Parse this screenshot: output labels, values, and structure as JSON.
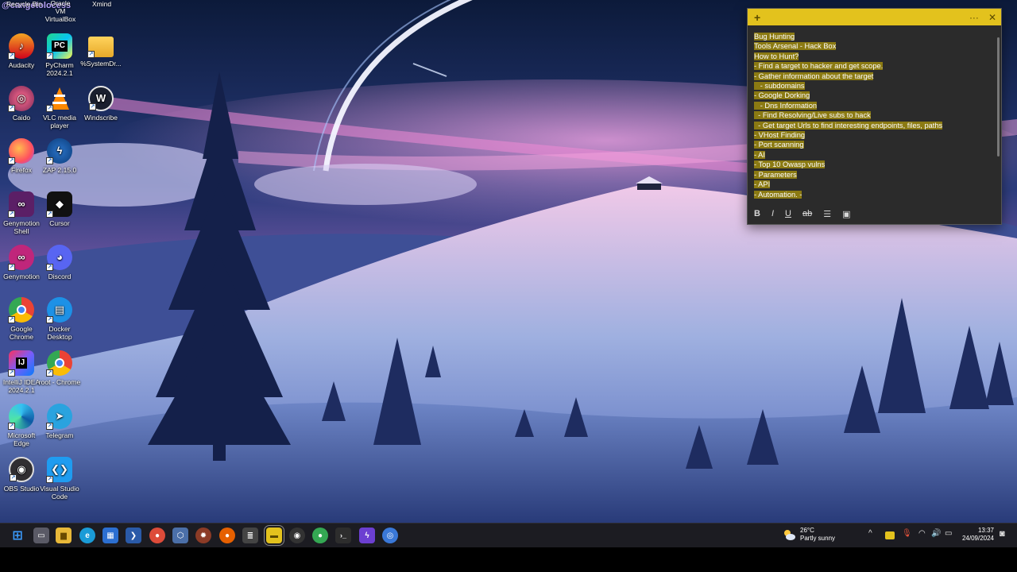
{
  "colors": {
    "sticky_accent": "#e3c21d",
    "sticky_bg": "#2b2b2b",
    "highlight": "#8b7a12",
    "taskbar_bg": "#1c1c22"
  },
  "overlay": {
    "handle": "@cangetolocess"
  },
  "top_labels": [
    "Recycle Bin",
    "Oracle VM VirtualBox",
    "Xmind"
  ],
  "desktop_icons": [
    {
      "label": "Audacity",
      "icon": "audacity-icon"
    },
    {
      "label": "PyCharm 2024.2.1",
      "icon": "pycharm-icon"
    },
    {
      "label": "%SystemDr...",
      "icon": "folder-icon"
    },
    {
      "label": "Caido",
      "icon": "caido-icon"
    },
    {
      "label": "VLC media player",
      "icon": "vlc-icon"
    },
    {
      "label": "Windscribe",
      "icon": "windscribe-icon"
    },
    {
      "label": "Firefox",
      "icon": "firefox-icon"
    },
    {
      "label": "ZAP 2.15.0",
      "icon": "zap-icon"
    },
    {
      "label": "Genymotion Shell",
      "icon": "genymotion-shell-icon"
    },
    {
      "label": "Cursor",
      "icon": "cursor-icon"
    },
    {
      "label": "Genymotion",
      "icon": "genymotion-icon"
    },
    {
      "label": "Discord",
      "icon": "discord-icon"
    },
    {
      "label": "Google Chrome",
      "icon": "chrome-icon"
    },
    {
      "label": "Docker Desktop",
      "icon": "docker-icon"
    },
    {
      "label": "IntelliJ IDEA 2024.2.1",
      "icon": "intellij-icon"
    },
    {
      "label": "root - Chrome",
      "icon": "chrome-profile-icon"
    },
    {
      "label": "Microsoft Edge",
      "icon": "edge-icon"
    },
    {
      "label": "Telegram",
      "icon": "telegram-icon"
    },
    {
      "label": "OBS Studio",
      "icon": "obs-icon"
    },
    {
      "label": "Visual Studio Code",
      "icon": "vscode-icon"
    }
  ],
  "sticky_note": {
    "menu_glyph": "···",
    "close_glyph": "✕",
    "add_glyph": "+",
    "lines": [
      "Bug Hunting",
      "Tools Arsenal - Hack Box",
      "How to Hunt?",
      "- Find a target to hacker and get scope.",
      "- Gather information about the target",
      "   - subdomains",
      "- Google Dorking",
      "   - Dns Information",
      "  - Find Resolving/Live subs to hack",
      "  - Get target Urls to find interesting endpoints, files, paths",
      "- VHost Finding",
      "- Port scanning",
      "- AI",
      "- Top 10 Owasp vulns",
      "- Parameters",
      "- API",
      "- Automation. -"
    ],
    "toolbar": {
      "bold": "B",
      "italic": "I",
      "underline": "U",
      "strike": "ab",
      "list": "☰",
      "image": "▣"
    }
  },
  "taskbar": {
    "apps": [
      {
        "name": "start-button",
        "glyph": "⊞",
        "color": "#3b9cff"
      },
      {
        "name": "task-view-button",
        "glyph": "▭",
        "color": "#5a5a66"
      },
      {
        "name": "file-explorer-button",
        "glyph": "▆",
        "color": "#e8b839"
      },
      {
        "name": "edge-button",
        "glyph": "e",
        "color": "#1a9bd7"
      },
      {
        "name": "store-button",
        "glyph": "▦",
        "color": "#2c6fd1"
      },
      {
        "name": "powershell-button",
        "glyph": "❯",
        "color": "#2a5aa8"
      },
      {
        "name": "chrome-taskbar-button",
        "glyph": "●",
        "color": "#dd4b39"
      },
      {
        "name": "virtualbox-taskbar-button",
        "glyph": "⬡",
        "color": "#4b6fa8"
      },
      {
        "name": "burp-taskbar-button",
        "glyph": "✹",
        "color": "#8c3b26"
      },
      {
        "name": "firefox-taskbar-button",
        "glyph": "●",
        "color": "#e66000"
      },
      {
        "name": "terminal-app-button",
        "glyph": "≣",
        "color": "#444"
      },
      {
        "name": "sticky-notes-button",
        "glyph": "▬",
        "color": "#e3c21d"
      },
      {
        "name": "obs-taskbar-button",
        "glyph": "◉",
        "color": "#333"
      },
      {
        "name": "chrome-profile-taskbar-button",
        "glyph": "●",
        "color": "#34a853"
      },
      {
        "name": "terminal-button",
        "glyph": "›_",
        "color": "#2d2d2d"
      },
      {
        "name": "vs-button",
        "glyph": "ϟ",
        "color": "#6c3fd1"
      },
      {
        "name": "app-button",
        "glyph": "◎",
        "color": "#3a78d8"
      }
    ],
    "weather_temp": "26°C",
    "weather_desc": "Partly sunny",
    "tray": {
      "chevron": "^",
      "mic": "🎙",
      "wifi": "◠",
      "volume": "🔊",
      "battery": "▭"
    },
    "time": "13:37",
    "date": "24/09/2024"
  }
}
